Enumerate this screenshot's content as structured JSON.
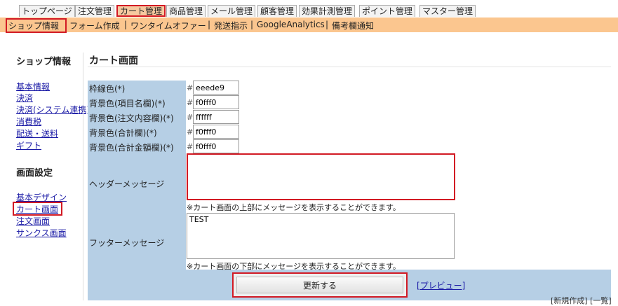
{
  "top_tabs": [
    {
      "label": "トップページ"
    },
    {
      "label": "注文管理"
    },
    {
      "label": "カート管理"
    },
    {
      "label": "商品管理"
    },
    {
      "label": "メール管理"
    },
    {
      "label": "顧客管理"
    },
    {
      "label": "効果計測管理"
    },
    {
      "label": "ポイント管理"
    },
    {
      "label": "マスター管理"
    }
  ],
  "sub_nav": {
    "items": [
      "ショップ情報",
      "フォーム作成",
      "ワンタイムオファー",
      "発送指示",
      "GoogleAnalytics",
      "備考欄通知"
    ],
    "separator": "|"
  },
  "side": {
    "heading1": "ショップ情報",
    "links1": [
      "基本情報",
      "決済",
      "決済(システム連携)",
      "消費税",
      "配送・送料",
      "ギフト"
    ],
    "heading2": "画面設定",
    "links2": [
      "基本デザイン",
      "カート画面",
      "注文画面",
      "サンクス画面"
    ]
  },
  "main": {
    "title": "カート画面",
    "hash": "#",
    "fields": [
      {
        "label": "枠線色(*)",
        "value": "eeede9"
      },
      {
        "label": "背景色(項目名欄)(*)",
        "value": "f0fff0"
      },
      {
        "label": "背景色(注文内容欄)(*)",
        "value": "ffffff"
      },
      {
        "label": "背景色(合計欄)(*)",
        "value": "f0fff0"
      },
      {
        "label": "背景色(合計金額欄)(*)",
        "value": "f0fff0"
      }
    ],
    "header_message": {
      "label": "ヘッダーメッセージ",
      "value": "",
      "note": "※カート画面の上部にメッセージを表示することができます。"
    },
    "footer_message": {
      "label": "フッターメッセージ",
      "value": "TEST",
      "note": "※カート画面の下部にメッセージを表示することができます。"
    },
    "update_button": "更新する",
    "preview_link": "[プレビュー]",
    "cut_text": "[新規作成] [一覧]"
  },
  "colors": {
    "highlight_red": "#d21a24",
    "subnav_orange": "#fbc68f",
    "label_blue": "#b6cfe5",
    "link_blue": "#1a1aa6"
  }
}
